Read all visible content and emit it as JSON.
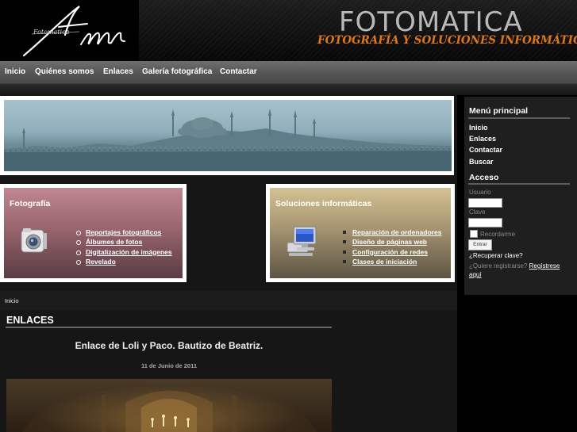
{
  "header": {
    "brand_name": "FOTOMATICA",
    "tagline": "FOTOGRAFÍA Y SOLUCIONES INFORMÁTICAS",
    "logo_script": "Fotomatica",
    "logo_monogram": "fm",
    "accent_color": "#e0771a"
  },
  "nav": {
    "items": [
      "Inicio",
      "Quiénes somos",
      "Enlaces",
      "Galería fotográfica",
      "Contactar"
    ]
  },
  "boxes": {
    "fotografia": {
      "title": "Fotografía",
      "icon": "camera-icon",
      "items": [
        "Reportajes fotográficos",
        "Álbumes de fotos",
        "Digitalización de imágenes",
        "Revelado"
      ]
    },
    "soluciones": {
      "title": "Soluciones informáticas",
      "icon": "computer-icon",
      "items": [
        "Reparación de ordenadores",
        "Diseño de páginas web",
        "Configuración de redes",
        "Clases de iniciación"
      ]
    }
  },
  "content": {
    "breadcrumb": "Inicio",
    "section_title": "ENLACES",
    "article_title": "Enlace de Loli y Paco. Bautizo de Beatriz.",
    "article_date": "11 de Junio de 2011"
  },
  "sidebar": {
    "menu_title": "Menú principal",
    "menu_items": [
      "Inicio",
      "Enlaces",
      "Contactar",
      "Buscar"
    ],
    "login_title": "Acceso",
    "username_label": "Usuario",
    "password_label": "Clave",
    "remember_label": "Recordarme",
    "login_button": "Entrar",
    "recover_link": "¿Recuperar clave?",
    "register_prompt": "¿Quiere registrarse?",
    "register_link": "Regístrese aquí"
  }
}
